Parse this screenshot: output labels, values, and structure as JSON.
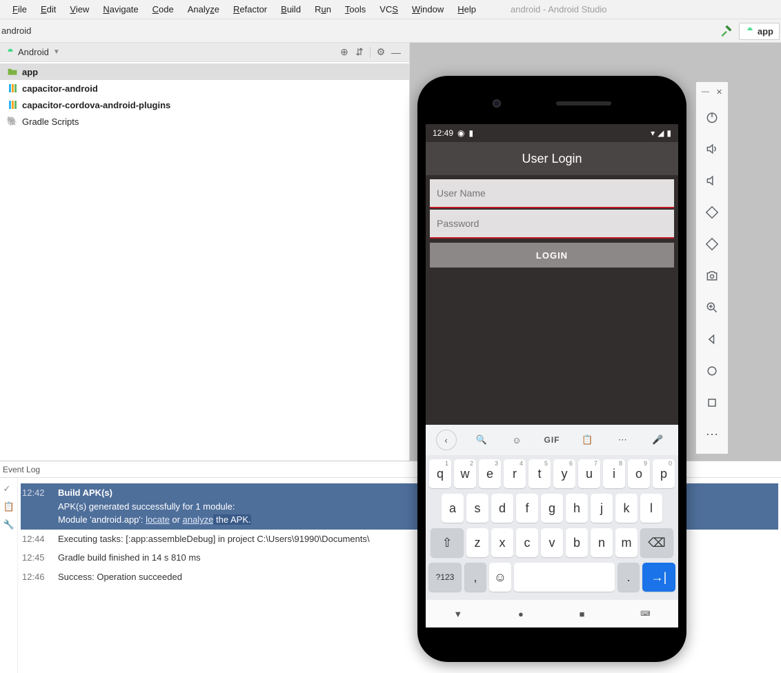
{
  "menu": {
    "items": [
      "File",
      "Edit",
      "View",
      "Navigate",
      "Code",
      "Analyze",
      "Refactor",
      "Build",
      "Run",
      "Tools",
      "VCS",
      "Window",
      "Help"
    ],
    "appTitle": "android - Android Studio"
  },
  "breadcrumb": {
    "path": "android"
  },
  "topRight": {
    "tabLabel": "app"
  },
  "projectPane": {
    "title": "Android",
    "items": [
      {
        "label": "app",
        "bold": true,
        "icon": "folder",
        "selected": true
      },
      {
        "label": "capacitor-android",
        "bold": true,
        "icon": "module"
      },
      {
        "label": "capacitor-cordova-android-plugins",
        "bold": true,
        "icon": "module"
      },
      {
        "label": "Gradle Scripts",
        "bold": false,
        "icon": "gradle"
      }
    ]
  },
  "eventLog": {
    "title": "Event Log",
    "rows": [
      {
        "time": "12:42",
        "selected": true,
        "lines": [
          "Build APK(s)",
          "APK(s) generated successfully for 1 module:",
          "Module 'android.app': locate or analyze the APK."
        ],
        "boldFirst": true
      },
      {
        "time": "12:44",
        "selected": false,
        "lines": [
          "Executing tasks: [:app:assembleDebug] in project C:\\Users\\91990\\Documents\\"
        ]
      },
      {
        "time": "12:45",
        "selected": false,
        "lines": [
          "Gradle build finished in 14 s 810 ms"
        ]
      },
      {
        "time": "12:46",
        "selected": false,
        "lines": [
          "Success: Operation succeeded"
        ]
      }
    ]
  },
  "emulator": {
    "statusTime": "12:49",
    "appBarTitle": "User Login",
    "userNamePlaceholder": "User Name",
    "passwordPlaceholder": "Password",
    "loginLabel": "LOGIN",
    "gifLabel": "GIF",
    "symKeyLabel": "?123",
    "keyboard": {
      "row1": [
        [
          "q",
          "1"
        ],
        [
          "w",
          "2"
        ],
        [
          "e",
          "3"
        ],
        [
          "r",
          "4"
        ],
        [
          "t",
          "5"
        ],
        [
          "y",
          "6"
        ],
        [
          "u",
          "7"
        ],
        [
          "i",
          "8"
        ],
        [
          "o",
          "9"
        ],
        [
          "p",
          "0"
        ]
      ],
      "row2": [
        "a",
        "s",
        "d",
        "f",
        "g",
        "h",
        "j",
        "k",
        "l"
      ],
      "row3": [
        "z",
        "x",
        "c",
        "v",
        "b",
        "n",
        "m"
      ]
    }
  }
}
